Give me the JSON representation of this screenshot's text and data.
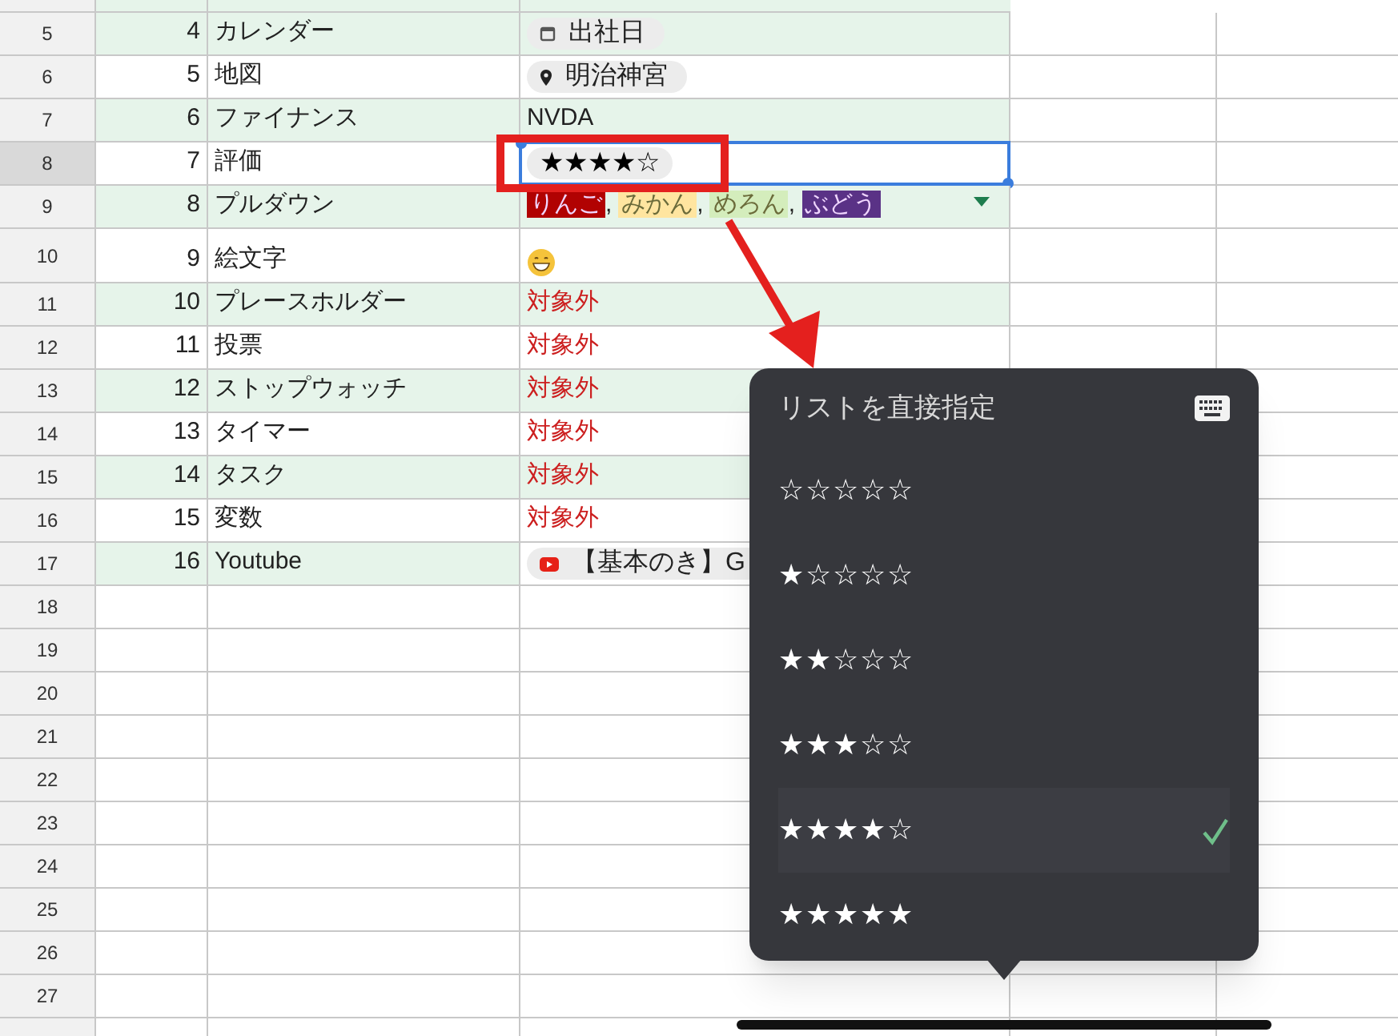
{
  "sheet": {
    "rows": [
      {
        "header": "5",
        "number": "4",
        "name": "カレンダー",
        "shaded": true,
        "value": {
          "kind": "calendar-chip",
          "text": "出社日"
        }
      },
      {
        "header": "6",
        "number": "5",
        "name": "地図",
        "shaded": false,
        "value": {
          "kind": "place-chip",
          "text": "明治神宮"
        }
      },
      {
        "header": "7",
        "number": "6",
        "name": "ファイナンス",
        "shaded": true,
        "value": {
          "kind": "text",
          "text": "NVDA"
        }
      },
      {
        "header": "8",
        "number": "7",
        "name": "評価",
        "shaded": false,
        "selected": true,
        "value": {
          "kind": "rating-chip",
          "text": "★★★★☆"
        }
      },
      {
        "header": "9",
        "number": "8",
        "name": "プルダウン",
        "shaded": true,
        "value": {
          "kind": "dropdown",
          "separator": ",",
          "chips": [
            {
              "text": "りんご",
              "color": "#b10202"
            },
            {
              "text": "みかん",
              "color": "#ffe5a0"
            },
            {
              "text": "めろん",
              "color": "#d4edbc"
            },
            {
              "text": "ぶどう",
              "color": "#5a3286"
            }
          ]
        }
      },
      {
        "header": "10",
        "number": "9",
        "name": "絵文字",
        "shaded": false,
        "tall": true,
        "value": {
          "kind": "emoji"
        }
      },
      {
        "header": "11",
        "number": "10",
        "name": "プレースホルダー",
        "shaded": true,
        "value": {
          "kind": "excluded",
          "text": "対象外"
        }
      },
      {
        "header": "12",
        "number": "11",
        "name": "投票",
        "shaded": false,
        "value": {
          "kind": "excluded",
          "text": "対象外"
        }
      },
      {
        "header": "13",
        "number": "12",
        "name": "ストップウォッチ",
        "shaded": true,
        "value": {
          "kind": "excluded",
          "text": "対象外"
        }
      },
      {
        "header": "14",
        "number": "13",
        "name": "タイマー",
        "shaded": false,
        "value": {
          "kind": "excluded",
          "text": "対象外"
        }
      },
      {
        "header": "15",
        "number": "14",
        "name": "タスク",
        "shaded": true,
        "value": {
          "kind": "excluded",
          "text": "対象外"
        }
      },
      {
        "header": "16",
        "number": "15",
        "name": "変数",
        "shaded": false,
        "value": {
          "kind": "excluded",
          "text": "対象外"
        }
      },
      {
        "header": "17",
        "number": "16",
        "name": "Youtube",
        "shaded": true,
        "value": {
          "kind": "video-chip",
          "text": "【基本のき】G"
        }
      }
    ],
    "empty_rows": [
      "18",
      "19",
      "20",
      "21",
      "22",
      "23",
      "24",
      "25",
      "26",
      "27"
    ]
  },
  "popup": {
    "title": "リストを直接指定",
    "options": [
      {
        "label": "☆☆☆☆☆",
        "selected": false
      },
      {
        "label": "★☆☆☆☆",
        "selected": false
      },
      {
        "label": "★★☆☆☆",
        "selected": false
      },
      {
        "label": "★★★☆☆",
        "selected": false
      },
      {
        "label": "★★★★☆",
        "selected": true
      },
      {
        "label": "★★★★★",
        "selected": false
      }
    ]
  }
}
